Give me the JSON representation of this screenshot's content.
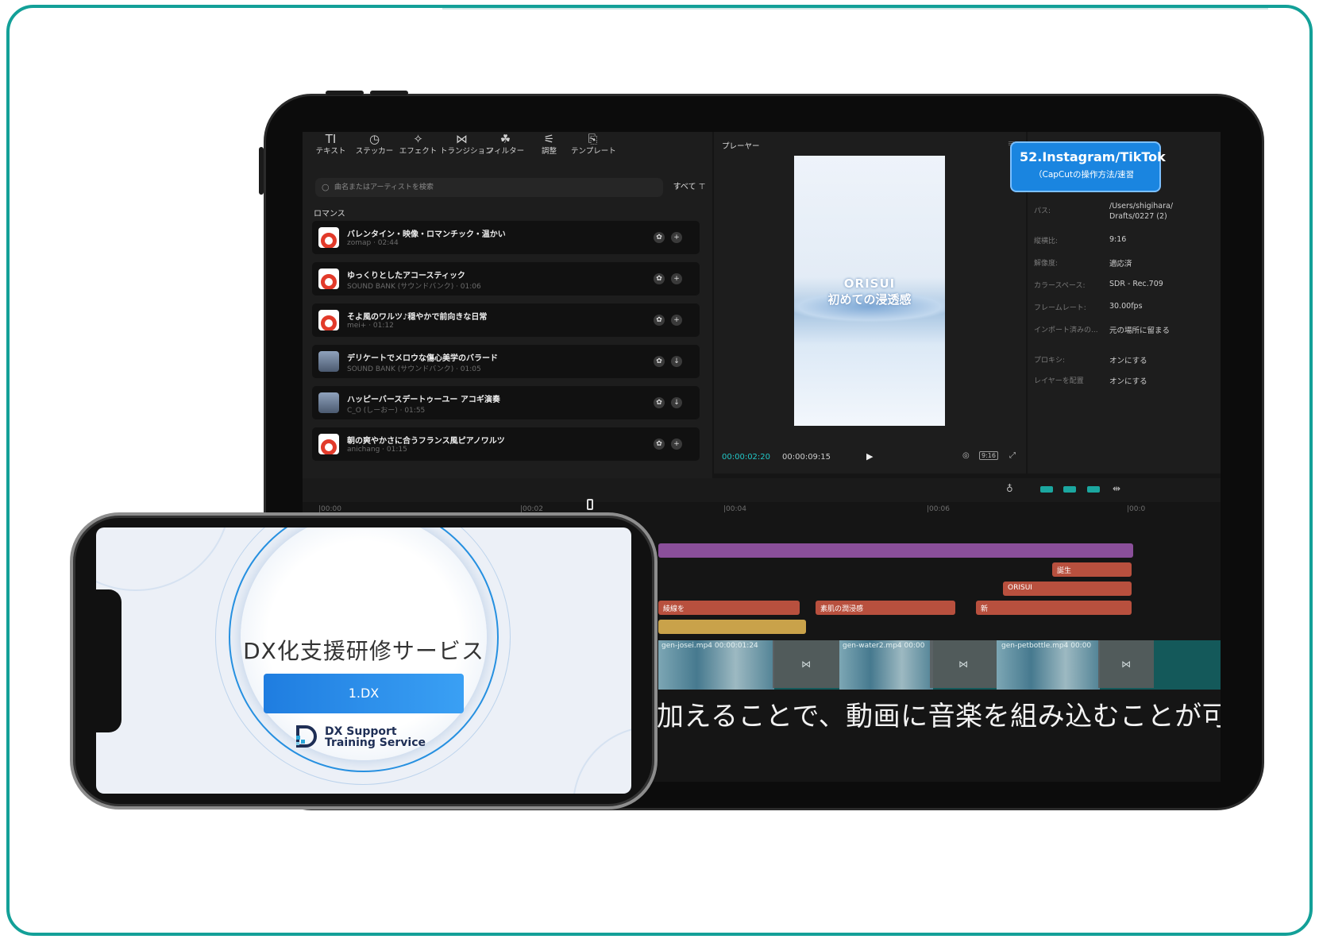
{
  "toolbar": {
    "tools": [
      {
        "icon": "TI",
        "label": "テキスト"
      },
      {
        "icon": "◷",
        "label": "ステッカー"
      },
      {
        "icon": "✧",
        "label": "エフェクト"
      },
      {
        "icon": "⋈",
        "label": "トランジション"
      },
      {
        "icon": "☘",
        "label": "フィルター"
      },
      {
        "icon": "⚟",
        "label": "調整"
      },
      {
        "icon": "⎘",
        "label": "テンプレート"
      }
    ]
  },
  "audio": {
    "search_placeholder": "曲名またはアーティストを検索",
    "filter_label": "すべて ⊤",
    "category": "ロマンス",
    "songs": [
      {
        "title": "バレンタイン・映像・ロマンチック・温かい",
        "sub": "zomap · 02:44",
        "action": "+"
      },
      {
        "title": "ゆっくりとしたアコースティック",
        "sub": "SOUND BANK (サウンドバンク) · 01:06",
        "action": "+"
      },
      {
        "title": "そよ風のワルツ♪穏やかで前向きな日常",
        "sub": "mei+ · 01:12",
        "action": "+"
      },
      {
        "title": "デリケートでメロウな傷心美学のバラード",
        "sub": "SOUND BANK (サウンドバンク) · 01:05",
        "action": "↓"
      },
      {
        "title": "ハッピーバースデートゥーユー アコギ演奏",
        "sub": "C_O (しーおー) · 01:55",
        "action": "↓"
      },
      {
        "title": "朝の爽やかさに合うフランス風ピアノワルツ",
        "sub": "anichang · 01:15",
        "action": "+"
      }
    ]
  },
  "player": {
    "title": "プレーヤー",
    "video_title_1": "ORISUI",
    "video_title_2": "初めての浸透感",
    "current_time": "00:00:02:20",
    "total_time": "00:00:09:15",
    "ratio_label": "9:16"
  },
  "info": {
    "badge_title": "52.Instagram/TikTok",
    "badge_sub": "（CapCutの操作方法/速習",
    "rows": [
      {
        "label": "パス:",
        "value": "/Users/shigihara/"
      },
      {
        "label": "",
        "value": "Drafts/0227 (2)"
      },
      {
        "label": "縦横比:",
        "value": "9:16"
      },
      {
        "label": "解像度:",
        "value": "適応済"
      },
      {
        "label": "カラースペース:",
        "value": "SDR - Rec.709"
      },
      {
        "label": "フレームレート:",
        "value": "30.00fps"
      },
      {
        "label": "インポート済みの...",
        "value": "元の場所に留まる"
      },
      {
        "label": "プロキシ:",
        "value": "オンにする"
      },
      {
        "label": "レイヤーを配置",
        "value": "オンにする"
      }
    ]
  },
  "timeline": {
    "ticks": [
      "|00:00",
      "|00:02",
      "|00:04",
      "|00:06",
      "|00:0"
    ],
    "text_clips": [
      "誕生",
      "ORISUI",
      "綾線を",
      "素肌の潤浸感",
      "新"
    ],
    "video_clips": [
      "gen-josei.mp4  00:00:01:24",
      "gen-water2.mp4  00:00",
      "gen-petbottle.mp4  00:00"
    ],
    "caption": "加えることで、動画に音楽を組み込むことが可能です。"
  },
  "phone": {
    "title": "DX化支援研修サービス",
    "button": "1.DX",
    "logo_line1": "DX Support",
    "logo_line2": "Training Service"
  },
  "colors": {
    "frame": "#13a098",
    "accent": "#1a85e0",
    "timeline_teal": "#1ba7a0",
    "clip_purple": "#8a4f9a",
    "clip_orange": "#b8503e",
    "clip_yellow": "#c9a24a"
  }
}
